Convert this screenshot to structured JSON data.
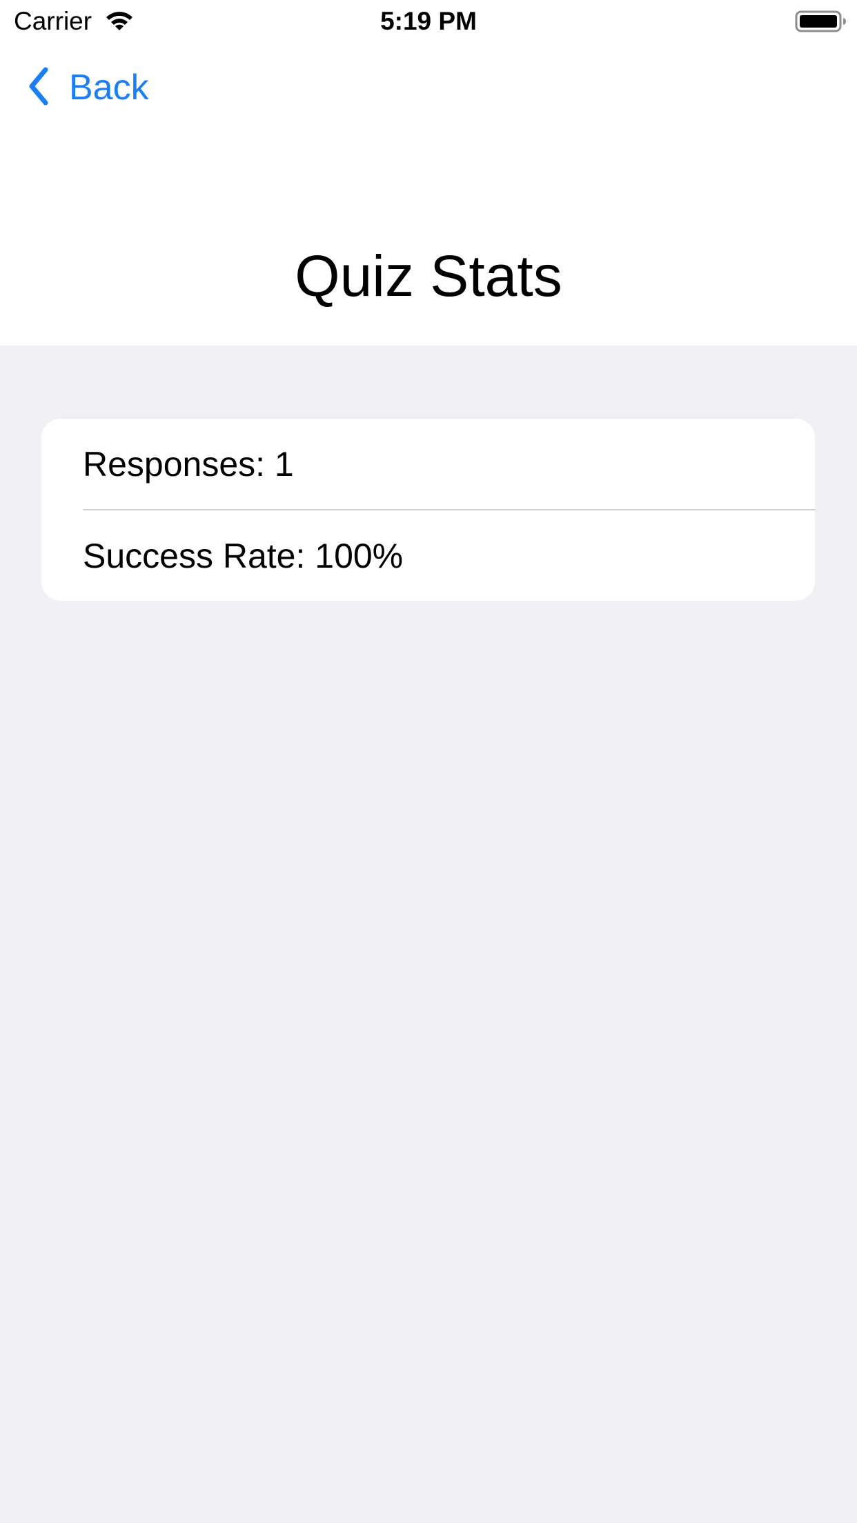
{
  "status_bar": {
    "carrier": "Carrier",
    "time": "5:19 PM",
    "wifi_icon": "wifi-icon",
    "battery_icon": "battery-icon"
  },
  "nav": {
    "back_label": "Back",
    "back_icon": "chevron-left-icon",
    "title": "Quiz Stats"
  },
  "stats": {
    "rows": [
      {
        "label": "Responses: 1"
      },
      {
        "label": "Success Rate: 100%"
      }
    ]
  },
  "colors": {
    "accent": "#1a7ff5",
    "background": "#f0f0f5",
    "card": "#ffffff",
    "divider": "#d2d2d6"
  }
}
